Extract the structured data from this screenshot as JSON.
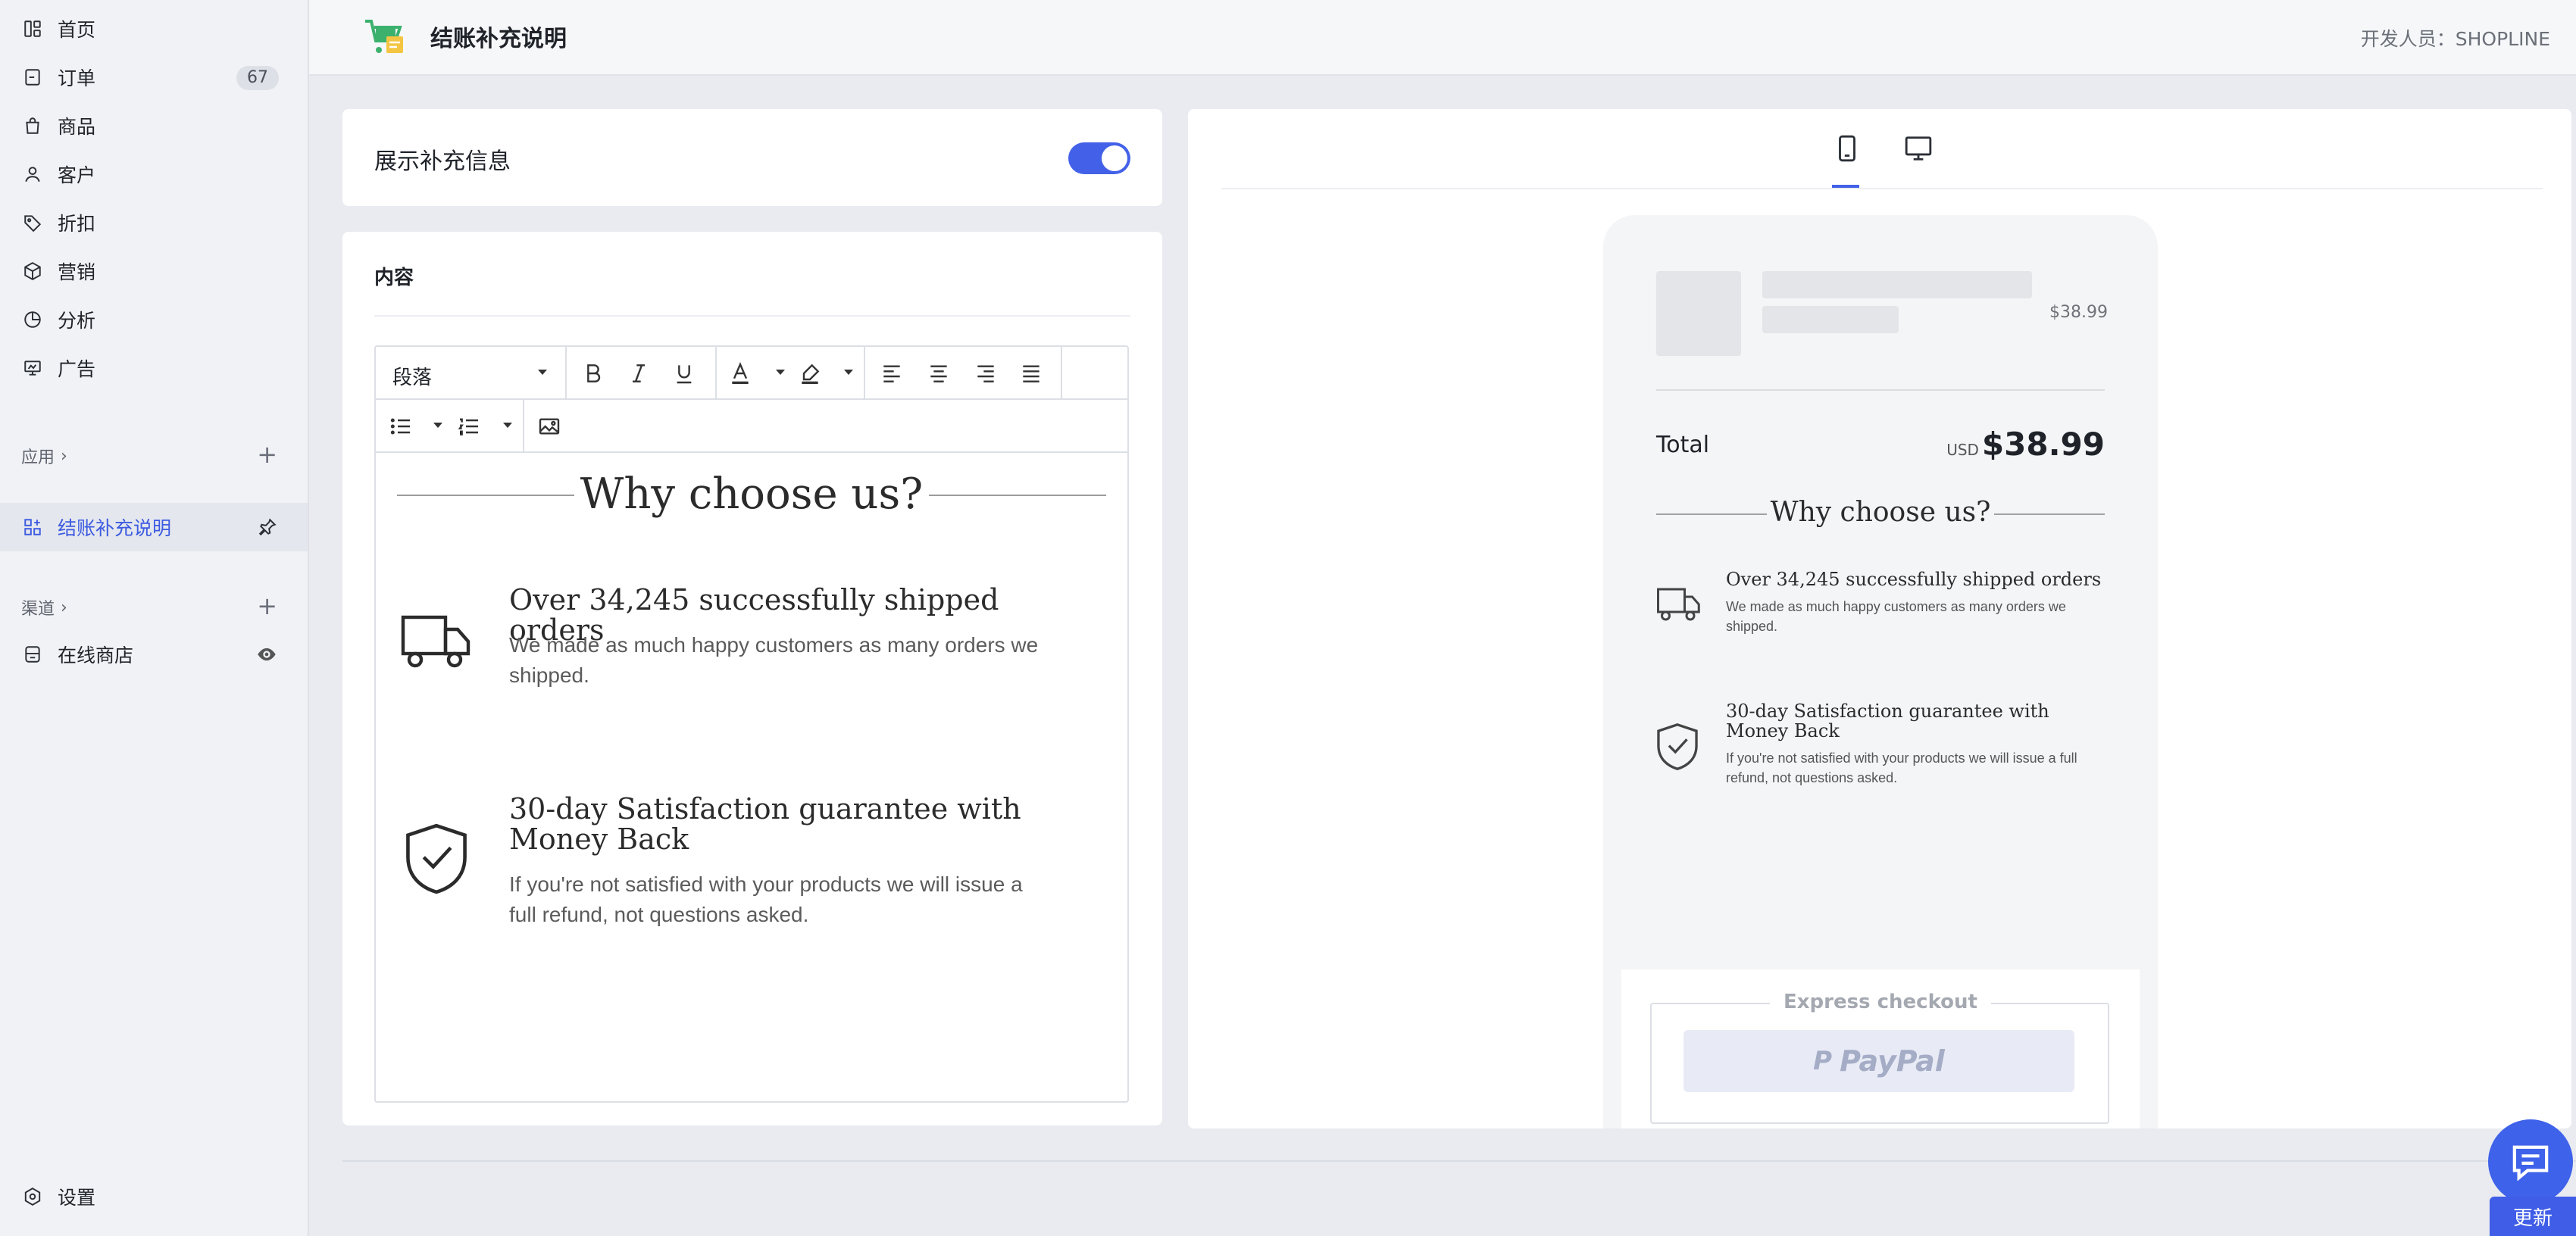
{
  "sidebar": {
    "items": [
      {
        "label": "首页",
        "icon": "dashboard-icon"
      },
      {
        "label": "订单",
        "icon": "order-icon",
        "badge": "67"
      },
      {
        "label": "商品",
        "icon": "bag-icon"
      },
      {
        "label": "客户",
        "icon": "person-icon"
      },
      {
        "label": "折扣",
        "icon": "tag-icon"
      },
      {
        "label": "营销",
        "icon": "cube-icon"
      },
      {
        "label": "分析",
        "icon": "pie-icon"
      },
      {
        "label": "广告",
        "icon": "ad-icon"
      }
    ],
    "apps_label": "应用",
    "active_app": "结账补充说明",
    "channels_label": "渠道",
    "channel_item": "在线商店",
    "settings": "设置"
  },
  "header": {
    "title": "结账补充说明",
    "developer": "开发人员：SHOPLINE"
  },
  "toggle_card": {
    "label": "展示补充信息",
    "enabled": true
  },
  "content_card": {
    "label": "内容",
    "paragraph_select": "段落"
  },
  "editor": {
    "heading": "Why choose us?",
    "features": [
      {
        "title": "Over 34,245 successfully shipped orders",
        "desc": "We made as much happy customers as many orders we shipped."
      },
      {
        "title": "30-day Satisfaction guarantee with Money Back",
        "desc": "If you're not satisfied with your products we will issue a full refund, not questions asked."
      }
    ]
  },
  "preview": {
    "item_price": "$38.99",
    "total_label": "Total",
    "currency": "USD",
    "total_value": "$38.99",
    "express_checkout": "Express checkout",
    "paypal": "PayPal"
  },
  "actions": {
    "update": "更新"
  },
  "colors": {
    "accent": "#4361e8",
    "sidebar_bg": "#f1f2f5"
  }
}
